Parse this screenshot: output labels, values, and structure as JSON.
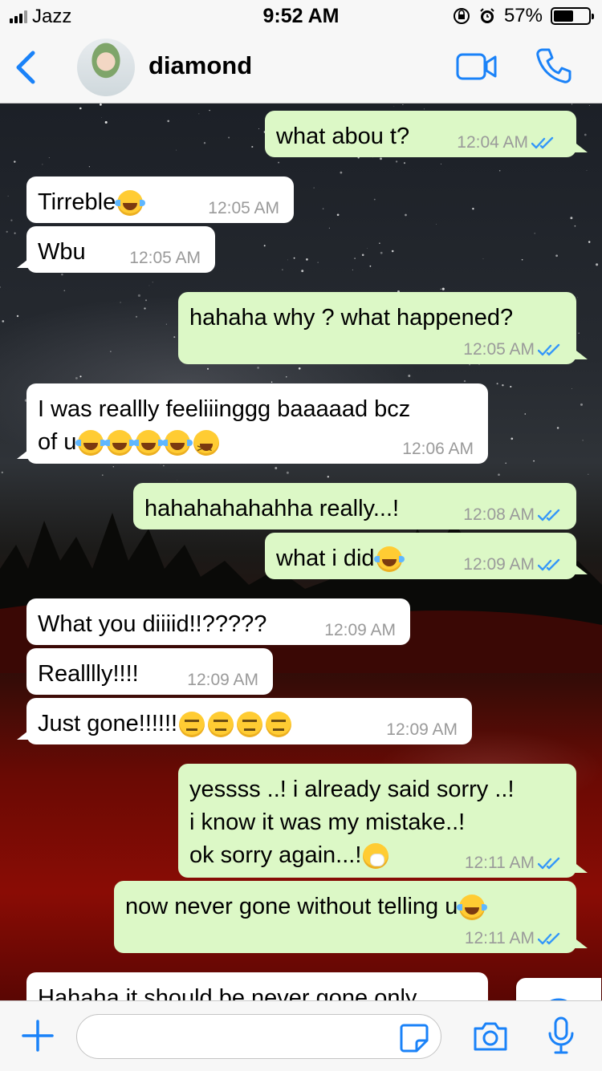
{
  "status_bar": {
    "carrier": "Jazz",
    "time": "9:52 AM",
    "battery": "57%",
    "battery_level": 0.57
  },
  "header": {
    "back_label": "",
    "contact_name": "diamond"
  },
  "messages": [
    {
      "dir": "out",
      "text": "what abou t?",
      "time": "12:04 AM",
      "read": true
    },
    {
      "dir": "in",
      "text": "Tirreble",
      "emoji": [
        "laugh"
      ],
      "time": "12:05 AM"
    },
    {
      "dir": "in",
      "text": "Wbu",
      "time": "12:05 AM"
    },
    {
      "dir": "out",
      "text": "hahaha why ? what happened?",
      "time": "12:05 AM",
      "read": true
    },
    {
      "dir": "in",
      "text": "I was reallly feeliiinggg baaaaad bcz\nof u",
      "emoji": [
        "laugh",
        "laugh",
        "laugh",
        "laugh",
        "squint"
      ],
      "time": "12:06 AM"
    },
    {
      "dir": "out",
      "text": "hahahahahahha really...!",
      "time": "12:08 AM",
      "read": true
    },
    {
      "dir": "out",
      "text": "what i did",
      "emoji": [
        "laugh"
      ],
      "time": "12:09 AM",
      "read": true
    },
    {
      "dir": "in",
      "text": "What you diiiid!!?????",
      "time": "12:09 AM"
    },
    {
      "dir": "in",
      "text": "Realllly!!!!",
      "time": "12:09 AM"
    },
    {
      "dir": "in",
      "text": "Just gone!!!!!!",
      "emoji": [
        "meh",
        "meh",
        "meh",
        "meh"
      ],
      "time": "12:09 AM"
    },
    {
      "dir": "out",
      "text": "yessss ..! i already said sorry ..!\ni know it was my mistake..!\nok sorry again...!",
      "emoji": [
        "sneeze"
      ],
      "time": "12:11 AM",
      "read": true
    },
    {
      "dir": "out",
      "text": "now never gone without telling u",
      "emoji": [
        "laugh"
      ],
      "time": "12:11 AM",
      "read": true
    },
    {
      "dir": "in",
      "text": "Hahaha it should be never gone only",
      "time": ""
    }
  ],
  "composer": {
    "placeholder": ""
  },
  "colors": {
    "accent": "#1a82f8",
    "outgoing_bubble": "#dcf8c6",
    "incoming_bubble": "#ffffff",
    "read_ticks": "#3497f9"
  },
  "icons": [
    "back-chevron-icon",
    "video-call-icon",
    "phone-call-icon",
    "attach-plus-icon",
    "sticker-icon",
    "camera-icon",
    "microphone-icon",
    "scroll-down-icon",
    "double-check-icon"
  ]
}
